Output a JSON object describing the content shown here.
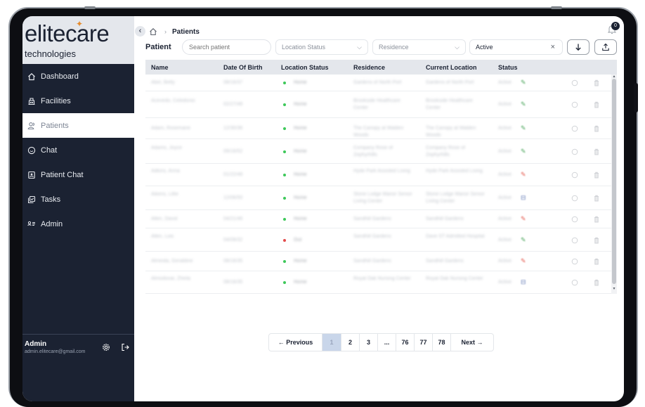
{
  "app": {
    "logo_main": "elite",
    "logo_main2": "care",
    "logo_sub": "technologies"
  },
  "sidebar": {
    "items": [
      {
        "label": "Dashboard",
        "icon": "home-icon"
      },
      {
        "label": "Facilities",
        "icon": "building-icon"
      },
      {
        "label": "Patients",
        "icon": "users-icon",
        "active": true
      },
      {
        "label": "Chat",
        "icon": "chat-icon"
      },
      {
        "label": "Patient Chat",
        "icon": "patient-chat-icon"
      },
      {
        "label": "Tasks",
        "icon": "tasks-icon"
      },
      {
        "label": "Admin",
        "icon": "admin-icon"
      }
    ],
    "user": {
      "name": "Admin",
      "email": "admin.elitecare@gmail.com"
    }
  },
  "header": {
    "breadcrumb_current": "Patients",
    "notification_count": "0"
  },
  "filters": {
    "label": "Patient",
    "search_placeholder": "Search patient",
    "location_status": "Location Status",
    "residence": "Residence",
    "status_value": "Active"
  },
  "table": {
    "columns": [
      "Name",
      "Date Of Birth",
      "Location Status",
      "Residence",
      "Current Location",
      "Status"
    ],
    "rows": [
      {
        "name": "Abel, Betty",
        "dob": "08/16/37",
        "loc": "Home",
        "res": "Gardens of North Port",
        "cur": "Gardens of North Port",
        "status": "Active",
        "icon": "green"
      },
      {
        "name": "Acevedo, Celedonio",
        "dob": "02/27/48",
        "loc": "Home",
        "res": "Brookside Healthcare Center",
        "cur": "Brookside Healthcare Center",
        "status": "Active",
        "icon": "green"
      },
      {
        "name": "Adam, Rosemarie",
        "dob": "12/30/36",
        "loc": "Home",
        "res": "The Canopy at Walden Woods",
        "cur": "The Canopy at Walden Woods",
        "status": "Active",
        "icon": "green"
      },
      {
        "name": "Adams, Joyce",
        "dob": "09/16/52",
        "loc": "Home",
        "res": "Company Rose of Zephyrhills",
        "cur": "Company Rose of Zephyrhills",
        "status": "Active",
        "icon": "green"
      },
      {
        "name": "Adkins, Anna",
        "dob": "01/22/48",
        "loc": "Home",
        "res": "Hyde Park Assisted Living",
        "cur": "Hyde Park Assisted Living",
        "status": "Active",
        "icon": "red"
      },
      {
        "name": "Aikens, Lillie",
        "dob": "12/06/50",
        "loc": "Home",
        "res": "Stone Lodge Manor Senior Living Center",
        "cur": "Stone Lodge Manor Senior Living Center",
        "status": "Active",
        "icon": "blue"
      },
      {
        "name": "Allen, David",
        "dob": "04/21/46",
        "loc": "Home",
        "res": "Sandhill Gardens",
        "cur": "Sandhill Gardens",
        "status": "Active",
        "icon": "red"
      },
      {
        "name": "Allen, Lois",
        "dob": "04/09/32",
        "loc": "Out",
        "res": "Sandhill Gardens",
        "cur": "Dave ST Admitted Hospital",
        "status": "Active",
        "icon": "green"
      },
      {
        "name": "Almeida, Geraldine",
        "dob": "08/16/35",
        "loc": "Home",
        "res": "Sandhill Gardens",
        "cur": "Sandhill Gardens",
        "status": "Active",
        "icon": "red"
      },
      {
        "name": "Almodovar, Zheila",
        "dob": "08/16/35",
        "loc": "Home",
        "res": "Royal Oak Nursing Center",
        "cur": "Royal Oak Nursing Center",
        "status": "Active",
        "icon": "blue"
      }
    ]
  },
  "pagination": {
    "prev": "Previous",
    "next": "Next",
    "pages": [
      "1",
      "2",
      "3",
      "...",
      "76",
      "77",
      "78"
    ],
    "current": "1"
  },
  "colors": {
    "sidebar_bg": "#1b2232",
    "home_dot": "#3ec85a",
    "out_dot": "#e34b4b",
    "header_bg": "#e4e7ec"
  }
}
